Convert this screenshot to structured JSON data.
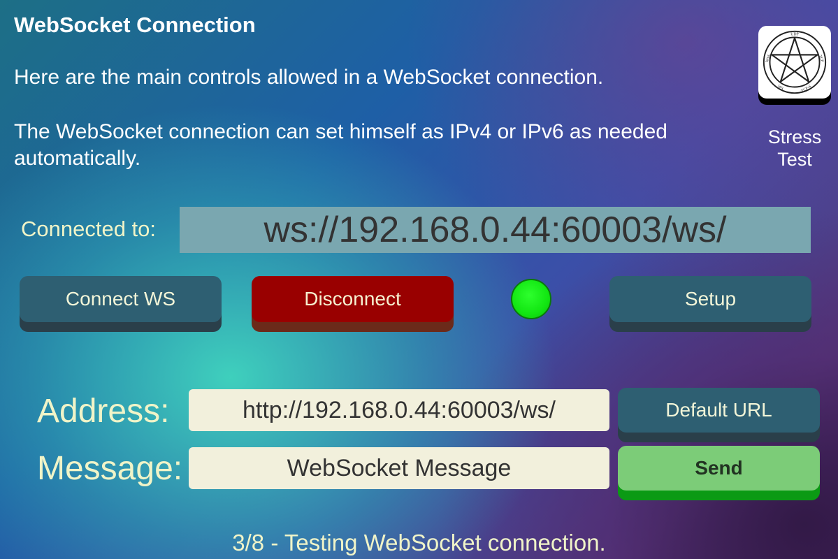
{
  "header": {
    "title": "WebSocket Connection",
    "description_1": "Here are the main controls allowed in a WebSocket connection.",
    "description_2": "The WebSocket connection can set himself as IPv4 or IPv6 as needed automatically."
  },
  "stress_test": {
    "label_line1": "Stress",
    "label_line2": "Test",
    "icon": "pentagram-seal-icon",
    "seal_text": [
      "UDP",
      "TCP",
      "TCP-S",
      "WS",
      "WSS"
    ]
  },
  "connection": {
    "connected_label": "Connected to:",
    "connected_url": "ws://192.168.0.44:60003/ws/",
    "status_color": "#12e612"
  },
  "buttons": {
    "connect": "Connect WS",
    "disconnect": "Disconnect",
    "setup": "Setup",
    "default_url": "Default URL",
    "send": "Send"
  },
  "form": {
    "address_label": "Address:",
    "address_value": "http://192.168.0.44:60003/ws/",
    "message_label": "Message:",
    "message_value": "WebSocket Message"
  },
  "status": {
    "text": "3/8 - Testing WebSocket connection."
  },
  "colors": {
    "connect_button": "#2e5f72",
    "disconnect_button": "#990000",
    "send_button": "#7ccc78"
  }
}
